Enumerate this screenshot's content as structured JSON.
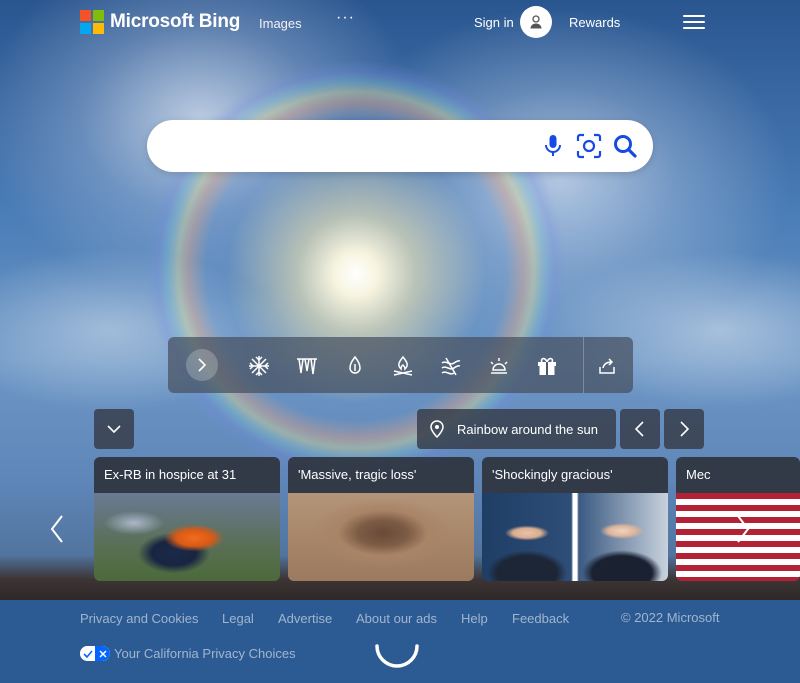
{
  "header": {
    "brand": "Microsoft Bing",
    "nav_images": "Images",
    "nav_more": "···",
    "sign_in": "Sign in",
    "rewards": "Rewards"
  },
  "search": {
    "value": "",
    "placeholder": "",
    "icons": [
      "microphone-icon",
      "visual-search-icon",
      "search-icon"
    ]
  },
  "toolbar": {
    "icons": [
      "chevron-right-icon",
      "snowflake-icon",
      "icicles-icon",
      "thermometer-icon",
      "campfire-icon",
      "wind-icon",
      "weather-alert-icon",
      "gift-icon",
      "share-icon"
    ]
  },
  "feed": {
    "location_label": "Rainbow around the sun",
    "cards": [
      {
        "title": "Ex-RB in hospice at 31"
      },
      {
        "title": "'Massive, tragic loss'"
      },
      {
        "title": "'Shockingly gracious'"
      },
      {
        "title": "Mec"
      }
    ]
  },
  "footer": {
    "links": [
      "Privacy and Cookies",
      "Legal",
      "Advertise",
      "About our ads",
      "Help",
      "Feedback"
    ],
    "copyright": "© 2022 Microsoft",
    "privacy_choices": "Your California Privacy Choices"
  },
  "colors": {
    "ms_red": "#f35325",
    "ms_green": "#81bc06",
    "ms_blue": "#05a6f0",
    "ms_yellow": "#ffba08",
    "search_icon_blue": "#174ae4",
    "footer_bg": "#2c5a93"
  }
}
